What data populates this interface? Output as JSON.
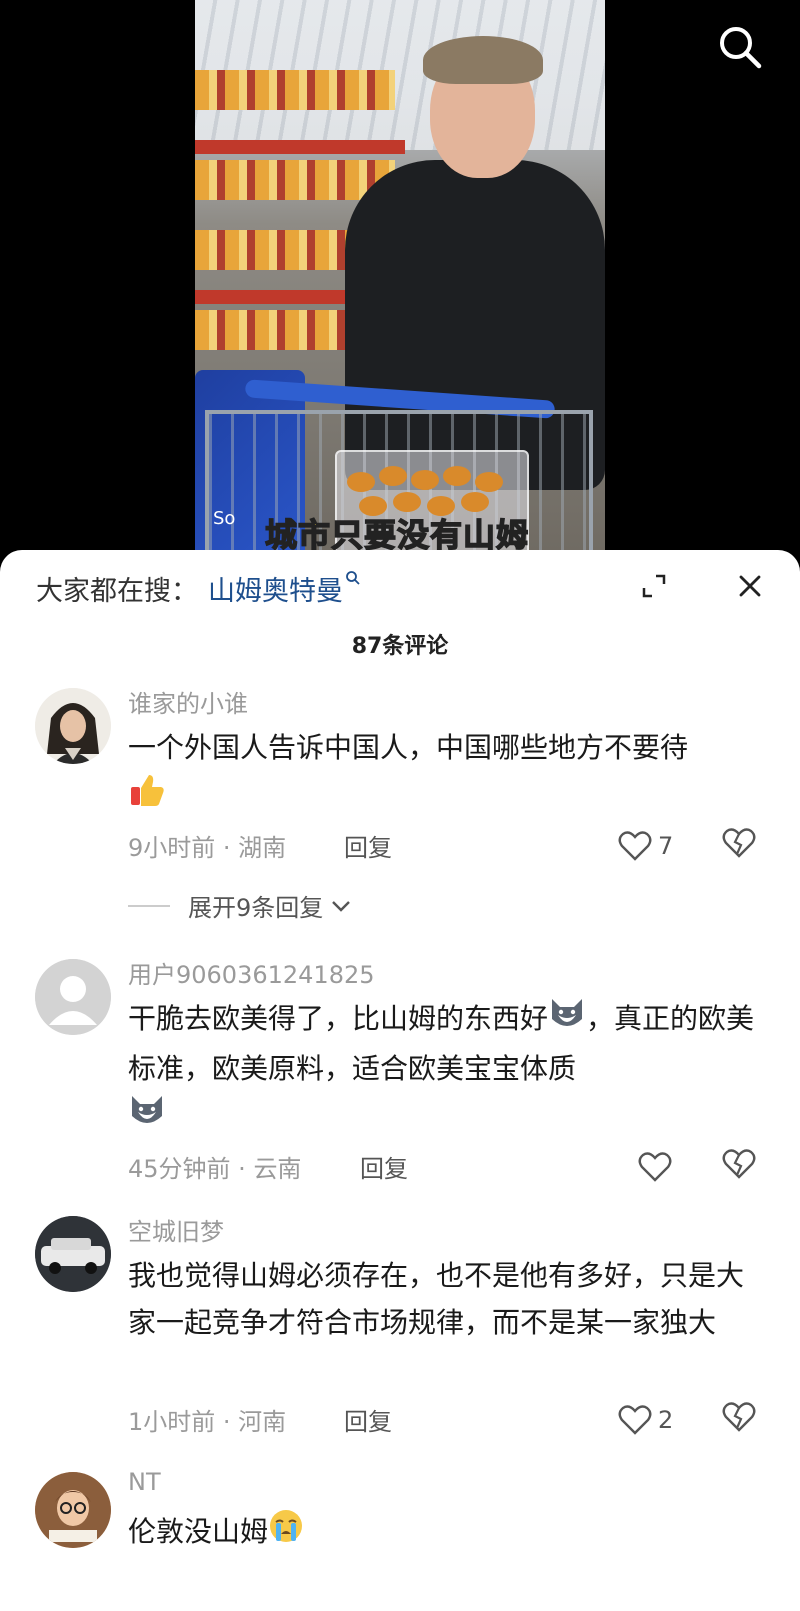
{
  "video": {
    "caption": "城市只要没有山姆",
    "watermark": "So"
  },
  "sheet": {
    "search_prefix": "大家都在搜：",
    "search_term": "山姆奥特曼",
    "comment_count_label": "87条评论"
  },
  "comments": [
    {
      "username": "谁家的小谁",
      "text": "一个外国人告诉中国人，中国哪些地方不要待",
      "emoji": "thumbs-up",
      "time": "9小时前",
      "location": "湖南",
      "reply_label": "回复",
      "likes": "7",
      "expand_replies_label": "展开9条回复"
    },
    {
      "username": "用户9060361241825",
      "text": "干脆去欧美得了，比山姆的东西好",
      "text2": "，真正的欧美标准，欧美原料，适合欧美宝宝体质",
      "emoji": "husky-face",
      "time": "45分钟前",
      "location": "云南",
      "reply_label": "回复",
      "likes": ""
    },
    {
      "username": "空城旧梦",
      "text": "我也觉得山姆必须存在，也不是他有多好，只是大家一起竞争才符合市场规律，而不是某一家独大",
      "time": "1小时前",
      "location": "河南",
      "reply_label": "回复",
      "likes": "2"
    },
    {
      "username": "NT",
      "text": "伦敦没山姆",
      "emoji": "crying-face"
    }
  ],
  "colors": {
    "search_term": "#1e4f8d",
    "caption": "#ffe14a",
    "muted": "#9a9a9a"
  }
}
